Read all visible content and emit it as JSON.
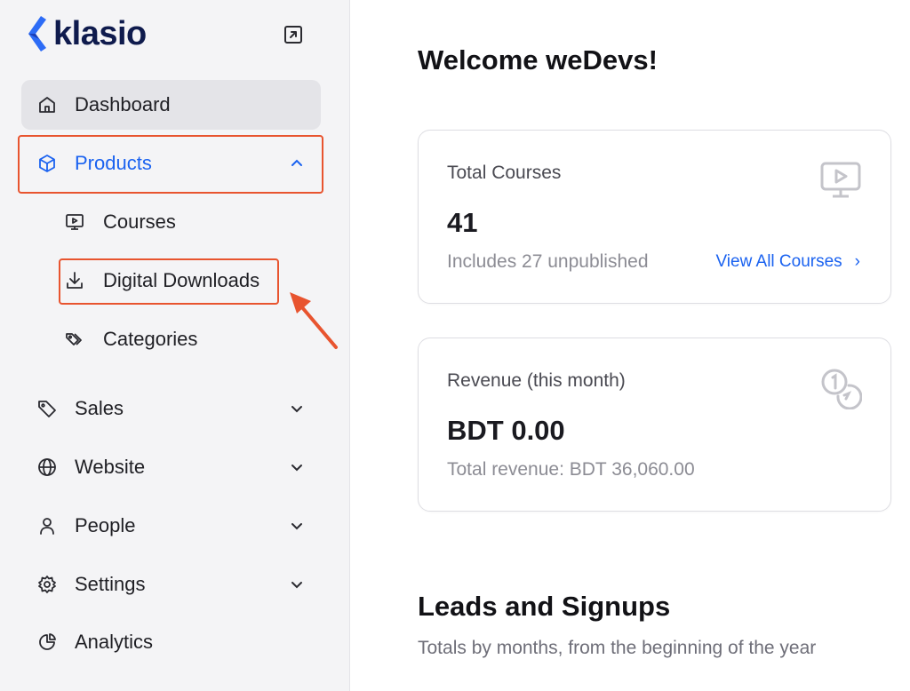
{
  "brand": {
    "name": "klasio",
    "accent": "#1a62f0",
    "highlight": "#e8542f"
  },
  "sidebar": {
    "items": [
      {
        "label": "Dashboard",
        "icon": "home-icon"
      },
      {
        "label": "Products",
        "icon": "box-icon",
        "expanded": true
      },
      {
        "label": "Sales",
        "icon": "tag-icon"
      },
      {
        "label": "Website",
        "icon": "globe-icon"
      },
      {
        "label": "People",
        "icon": "user-icon"
      },
      {
        "label": "Settings",
        "icon": "gear-icon"
      },
      {
        "label": "Analytics",
        "icon": "pie-chart-icon"
      }
    ],
    "products_sub": [
      {
        "label": "Courses",
        "icon": "monitor-play-icon"
      },
      {
        "label": "Digital Downloads",
        "icon": "download-icon"
      },
      {
        "label": "Categories",
        "icon": "tags-icon"
      }
    ]
  },
  "main": {
    "welcome": "Welcome weDevs!",
    "courses_card": {
      "title": "Total Courses",
      "value": "41",
      "subtitle": "Includes 27 unpublished",
      "link": "View All Courses",
      "link_arrow": "›"
    },
    "revenue_card": {
      "title": "Revenue (this month)",
      "value": "BDT 0.00",
      "subtitle": "Total revenue: BDT 36,060.00"
    },
    "leads": {
      "title": "Leads and Signups",
      "subtitle": "Totals by months, from the beginning of the year"
    }
  }
}
